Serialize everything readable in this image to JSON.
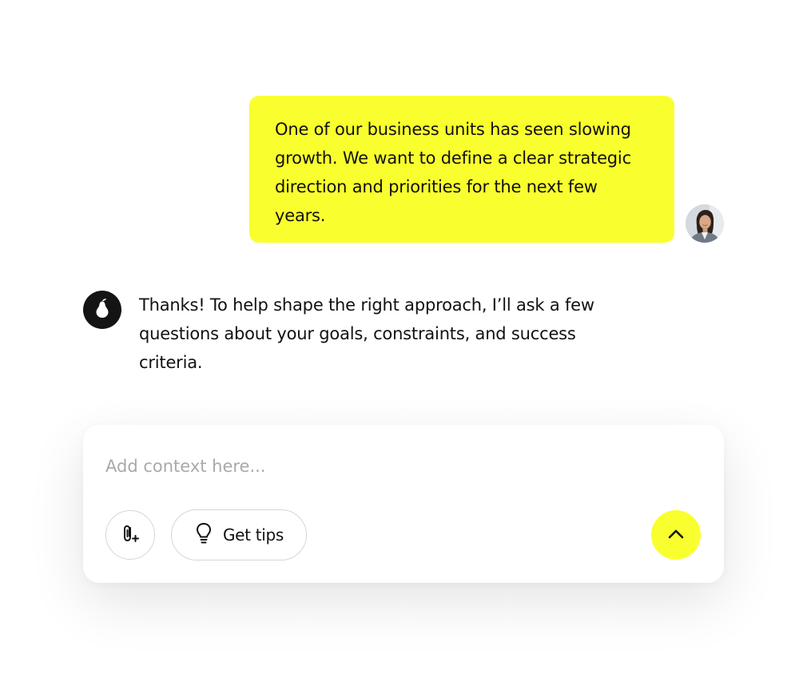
{
  "conversation": {
    "user_message": "One of our business units has seen slowing growth. We want to define a clear strategic direction and priorities for the next few years.",
    "assistant_message": "Thanks! To help shape the right approach, I’ll ask a few questions about your goals, constraints, and success criteria.",
    "user_avatar": "user-photo-avatar",
    "assistant_avatar": "pear-logo-icon"
  },
  "composer": {
    "placeholder": "Add context here...",
    "value": "",
    "attach_icon": "paperclip-plus-icon",
    "tips_icon": "lightbulb-icon",
    "tips_label": "Get tips",
    "send_icon": "chevron-up-icon"
  },
  "colors": {
    "accent": "#f9ff2e",
    "assistant_avatar_bg": "#141414",
    "placeholder_text": "#a9a9a9"
  }
}
